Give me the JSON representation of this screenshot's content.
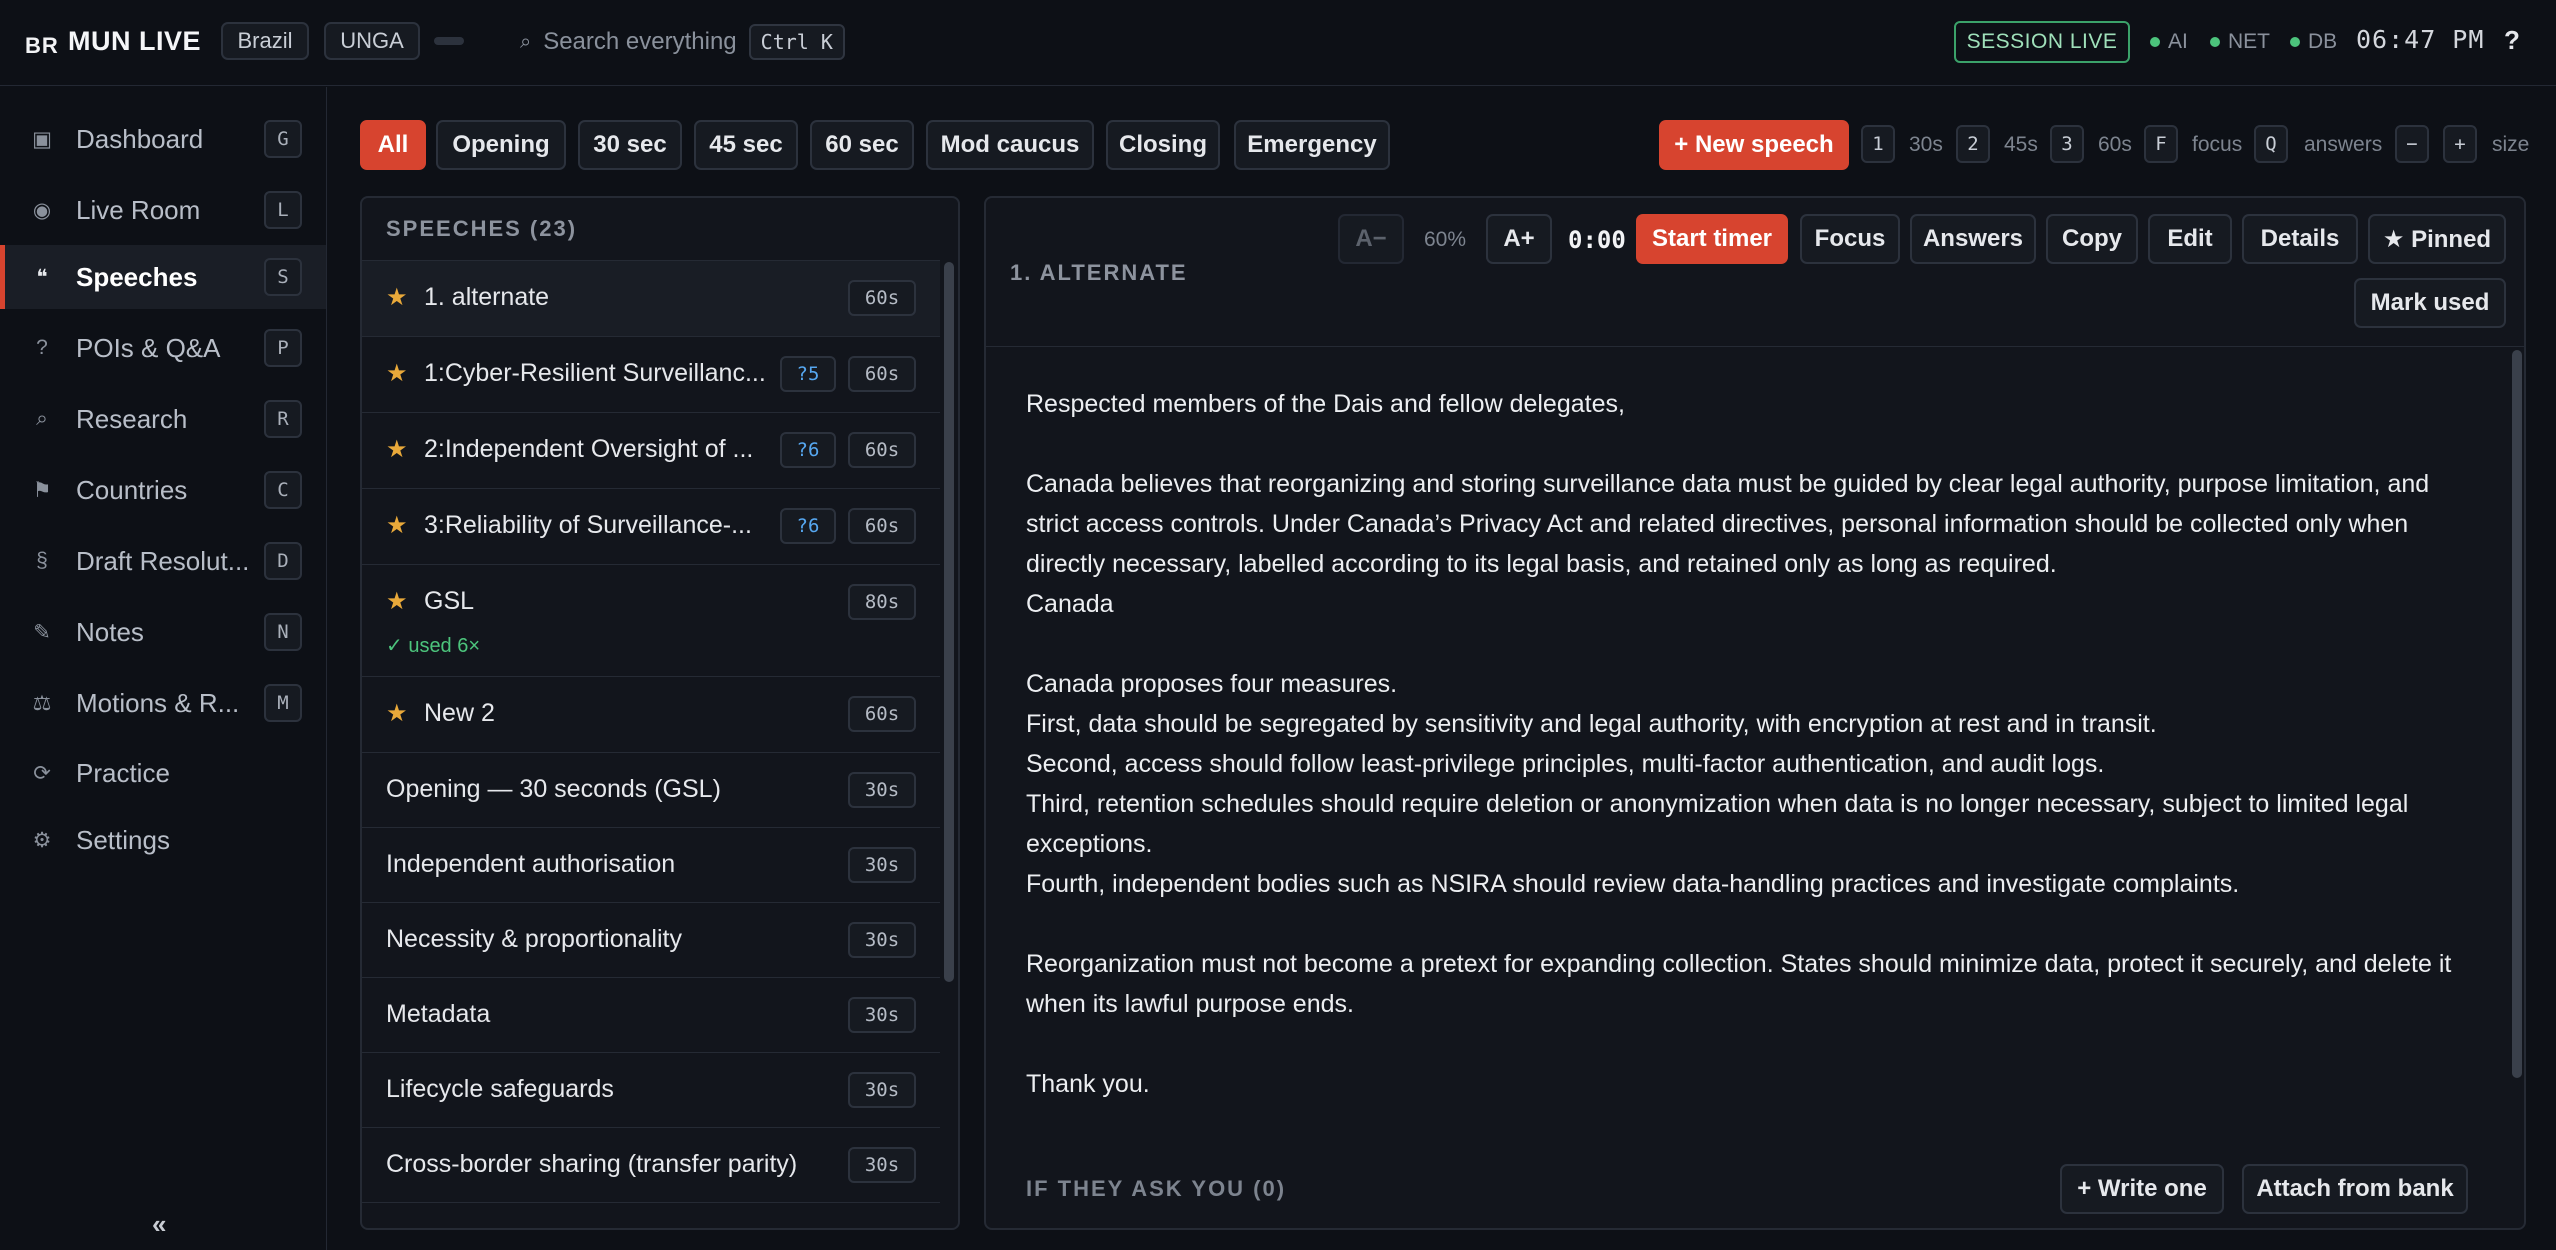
{
  "app": {
    "logo_mark": "BR",
    "title": "MUN LIVE",
    "country": "Brazil",
    "committee": "UNGA",
    "search_placeholder": "Search everything",
    "search_shortcut": "Ctrl K",
    "session_status": "SESSION LIVE",
    "status_ai": "AI",
    "status_net": "NET",
    "status_db": "DB",
    "clock": "06:47 PM",
    "help": "?"
  },
  "sidebar": {
    "items": [
      {
        "label": "Dashboard",
        "key": "G",
        "icon": "▣",
        "icon_name": "dashboard-icon"
      },
      {
        "label": "Live Room",
        "key": "L",
        "icon": "◉",
        "icon_name": "live-room-icon"
      },
      {
        "label": "Speeches",
        "key": "S",
        "icon": "❝",
        "icon_name": "quote-icon"
      },
      {
        "label": "POIs & Q&A",
        "key": "P",
        "icon": "?",
        "icon_name": "question-icon"
      },
      {
        "label": "Research",
        "key": "R",
        "icon": "⌕",
        "icon_name": "search-icon"
      },
      {
        "label": "Countries",
        "key": "C",
        "icon": "⚑",
        "icon_name": "flag-icon"
      },
      {
        "label": "Draft Resolut...",
        "key": "D",
        "icon": "§",
        "icon_name": "section-icon"
      },
      {
        "label": "Notes",
        "key": "N",
        "icon": "✎",
        "icon_name": "pencil-icon"
      },
      {
        "label": "Motions & R...",
        "key": "M",
        "icon": "⚖",
        "icon_name": "scales-icon"
      },
      {
        "label": "Practice",
        "key": "",
        "icon": "⟳",
        "icon_name": "practice-icon"
      },
      {
        "label": "Settings",
        "key": "",
        "icon": "⚙",
        "icon_name": "gear-icon"
      }
    ],
    "collapse": "«"
  },
  "filters": [
    "All",
    "Opening",
    "30 sec",
    "45 sec",
    "60 sec",
    "Mod caucus",
    "Closing",
    "Emergency"
  ],
  "toolbar": {
    "new_speech": "+ New speech",
    "shortcuts": [
      {
        "key": "1",
        "label": "30s"
      },
      {
        "key": "2",
        "label": "45s"
      },
      {
        "key": "3",
        "label": "60s"
      },
      {
        "key": "F",
        "label": "focus"
      },
      {
        "key": "Q",
        "label": "answers"
      },
      {
        "key": "−",
        "label": ""
      },
      {
        "key": "+",
        "label": "size"
      }
    ]
  },
  "list": {
    "heading": "SPEECHES (23)",
    "rows": [
      {
        "title": "1. alternate",
        "time": "60s",
        "q": "",
        "used": ""
      },
      {
        "title": "1:Cyber-Resilient Surveillanc...",
        "time": "60s",
        "q": "?5",
        "used": ""
      },
      {
        "title": "2:Independent Oversight of ...",
        "time": "60s",
        "q": "?6",
        "used": ""
      },
      {
        "title": "3:Reliability of Surveillance-...",
        "time": "60s",
        "q": "?6",
        "used": ""
      },
      {
        "title": "GSL",
        "time": "80s",
        "q": "",
        "used": "✓ used 6×"
      },
      {
        "title": "New 2",
        "time": "60s",
        "q": "",
        "used": ""
      },
      {
        "title": "Opening — 30 seconds (GSL)",
        "time": "30s",
        "q": "",
        "used": ""
      },
      {
        "title": "Independent authorisation",
        "time": "30s",
        "q": "",
        "used": ""
      },
      {
        "title": "Necessity & proportionality",
        "time": "30s",
        "q": "",
        "used": ""
      },
      {
        "title": "Metadata",
        "time": "30s",
        "q": "",
        "used": ""
      },
      {
        "title": "Lifecycle safeguards",
        "time": "30s",
        "q": "",
        "used": ""
      },
      {
        "title": "Cross-border sharing (transfer parity)",
        "time": "30s",
        "q": "",
        "used": ""
      }
    ]
  },
  "detail": {
    "title": "1. ALTERNATE",
    "font_minus": "A−",
    "zoom": "60%",
    "font_plus": "A+",
    "timer": "0:00",
    "start_timer": "Start timer",
    "focus": "Focus",
    "answers": "Answers",
    "copy": "Copy",
    "edit": "Edit",
    "details": "Details",
    "pinned": "★ Pinned",
    "mark_used": "Mark used",
    "body": [
      "Respected members of the Dais and fellow delegates,",
      "",
      "Canada believes that reorganizing and storing surveillance data must be guided by clear legal authority, purpose limitation, and strict access controls. Under Canada’s Privacy Act and related directives, personal information should be collected only when directly necessary, labelled according to its legal basis, and retained only as long as required.",
      "Canada",
      "",
      "Canada proposes four measures.",
      "First, data should be segregated by sensitivity and legal authority, with encryption at rest and in transit.",
      "Second, access should follow least-privilege principles, multi-factor authentication, and audit logs.",
      "Third, retention schedules should require deletion or anonymization when data is no longer necessary, subject to limited legal exceptions.",
      "Fourth, independent bodies such as NSIRA should review data-handling practices and investigate complaints.",
      "",
      "Reorganization must not become a pretext for expanding collection. States should minimize data, protect it securely, and delete it when its lawful purpose ends.",
      "",
      "Thank you."
    ],
    "ask_heading": "IF THEY ASK YOU (0)",
    "write_one": "+ Write one",
    "attach": "Attach from bank"
  },
  "colors": {
    "accent": "#d7442f",
    "star": "#e9a93a",
    "live": "#3ba26a",
    "question_badge": "#56a7f0"
  }
}
